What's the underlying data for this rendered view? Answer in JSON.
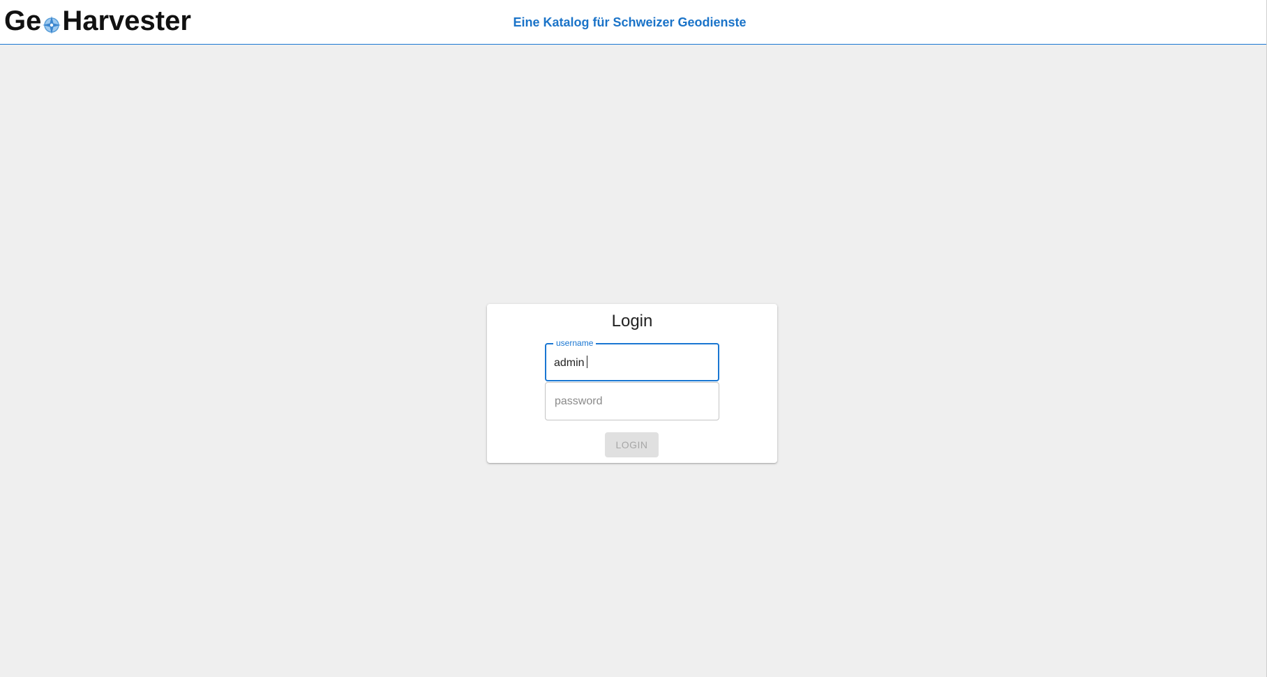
{
  "header": {
    "logo": {
      "text_before": "Ge",
      "text_after": "Harvester",
      "icon": "compass-icon"
    },
    "tagline": "Eine Katalog für Schweizer Geodienste"
  },
  "login": {
    "title": "Login",
    "username": {
      "label": "username",
      "value": "admin"
    },
    "password": {
      "placeholder": "password",
      "value": ""
    },
    "submit_label": "LOGIN"
  },
  "colors": {
    "accent": "#1976d2",
    "tagline": "#1a73c8",
    "background": "#efefef"
  }
}
